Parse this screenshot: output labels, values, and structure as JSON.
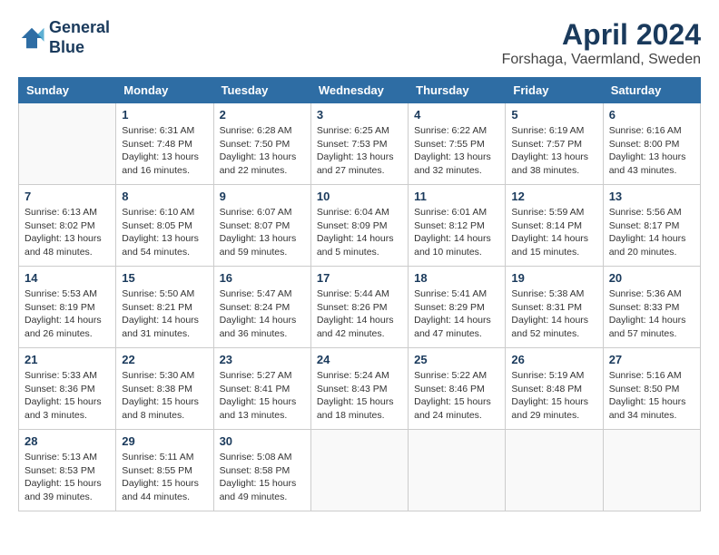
{
  "header": {
    "logo_line1": "General",
    "logo_line2": "Blue",
    "title": "April 2024",
    "subtitle": "Forshaga, Vaermland, Sweden"
  },
  "weekdays": [
    "Sunday",
    "Monday",
    "Tuesday",
    "Wednesday",
    "Thursday",
    "Friday",
    "Saturday"
  ],
  "weeks": [
    [
      {
        "day": "",
        "info": ""
      },
      {
        "day": "1",
        "info": "Sunrise: 6:31 AM\nSunset: 7:48 PM\nDaylight: 13 hours\nand 16 minutes."
      },
      {
        "day": "2",
        "info": "Sunrise: 6:28 AM\nSunset: 7:50 PM\nDaylight: 13 hours\nand 22 minutes."
      },
      {
        "day": "3",
        "info": "Sunrise: 6:25 AM\nSunset: 7:53 PM\nDaylight: 13 hours\nand 27 minutes."
      },
      {
        "day": "4",
        "info": "Sunrise: 6:22 AM\nSunset: 7:55 PM\nDaylight: 13 hours\nand 32 minutes."
      },
      {
        "day": "5",
        "info": "Sunrise: 6:19 AM\nSunset: 7:57 PM\nDaylight: 13 hours\nand 38 minutes."
      },
      {
        "day": "6",
        "info": "Sunrise: 6:16 AM\nSunset: 8:00 PM\nDaylight: 13 hours\nand 43 minutes."
      }
    ],
    [
      {
        "day": "7",
        "info": "Sunrise: 6:13 AM\nSunset: 8:02 PM\nDaylight: 13 hours\nand 48 minutes."
      },
      {
        "day": "8",
        "info": "Sunrise: 6:10 AM\nSunset: 8:05 PM\nDaylight: 13 hours\nand 54 minutes."
      },
      {
        "day": "9",
        "info": "Sunrise: 6:07 AM\nSunset: 8:07 PM\nDaylight: 13 hours\nand 59 minutes."
      },
      {
        "day": "10",
        "info": "Sunrise: 6:04 AM\nSunset: 8:09 PM\nDaylight: 14 hours\nand 5 minutes."
      },
      {
        "day": "11",
        "info": "Sunrise: 6:01 AM\nSunset: 8:12 PM\nDaylight: 14 hours\nand 10 minutes."
      },
      {
        "day": "12",
        "info": "Sunrise: 5:59 AM\nSunset: 8:14 PM\nDaylight: 14 hours\nand 15 minutes."
      },
      {
        "day": "13",
        "info": "Sunrise: 5:56 AM\nSunset: 8:17 PM\nDaylight: 14 hours\nand 20 minutes."
      }
    ],
    [
      {
        "day": "14",
        "info": "Sunrise: 5:53 AM\nSunset: 8:19 PM\nDaylight: 14 hours\nand 26 minutes."
      },
      {
        "day": "15",
        "info": "Sunrise: 5:50 AM\nSunset: 8:21 PM\nDaylight: 14 hours\nand 31 minutes."
      },
      {
        "day": "16",
        "info": "Sunrise: 5:47 AM\nSunset: 8:24 PM\nDaylight: 14 hours\nand 36 minutes."
      },
      {
        "day": "17",
        "info": "Sunrise: 5:44 AM\nSunset: 8:26 PM\nDaylight: 14 hours\nand 42 minutes."
      },
      {
        "day": "18",
        "info": "Sunrise: 5:41 AM\nSunset: 8:29 PM\nDaylight: 14 hours\nand 47 minutes."
      },
      {
        "day": "19",
        "info": "Sunrise: 5:38 AM\nSunset: 8:31 PM\nDaylight: 14 hours\nand 52 minutes."
      },
      {
        "day": "20",
        "info": "Sunrise: 5:36 AM\nSunset: 8:33 PM\nDaylight: 14 hours\nand 57 minutes."
      }
    ],
    [
      {
        "day": "21",
        "info": "Sunrise: 5:33 AM\nSunset: 8:36 PM\nDaylight: 15 hours\nand 3 minutes."
      },
      {
        "day": "22",
        "info": "Sunrise: 5:30 AM\nSunset: 8:38 PM\nDaylight: 15 hours\nand 8 minutes."
      },
      {
        "day": "23",
        "info": "Sunrise: 5:27 AM\nSunset: 8:41 PM\nDaylight: 15 hours\nand 13 minutes."
      },
      {
        "day": "24",
        "info": "Sunrise: 5:24 AM\nSunset: 8:43 PM\nDaylight: 15 hours\nand 18 minutes."
      },
      {
        "day": "25",
        "info": "Sunrise: 5:22 AM\nSunset: 8:46 PM\nDaylight: 15 hours\nand 24 minutes."
      },
      {
        "day": "26",
        "info": "Sunrise: 5:19 AM\nSunset: 8:48 PM\nDaylight: 15 hours\nand 29 minutes."
      },
      {
        "day": "27",
        "info": "Sunrise: 5:16 AM\nSunset: 8:50 PM\nDaylight: 15 hours\nand 34 minutes."
      }
    ],
    [
      {
        "day": "28",
        "info": "Sunrise: 5:13 AM\nSunset: 8:53 PM\nDaylight: 15 hours\nand 39 minutes."
      },
      {
        "day": "29",
        "info": "Sunrise: 5:11 AM\nSunset: 8:55 PM\nDaylight: 15 hours\nand 44 minutes."
      },
      {
        "day": "30",
        "info": "Sunrise: 5:08 AM\nSunset: 8:58 PM\nDaylight: 15 hours\nand 49 minutes."
      },
      {
        "day": "",
        "info": ""
      },
      {
        "day": "",
        "info": ""
      },
      {
        "day": "",
        "info": ""
      },
      {
        "day": "",
        "info": ""
      }
    ]
  ]
}
